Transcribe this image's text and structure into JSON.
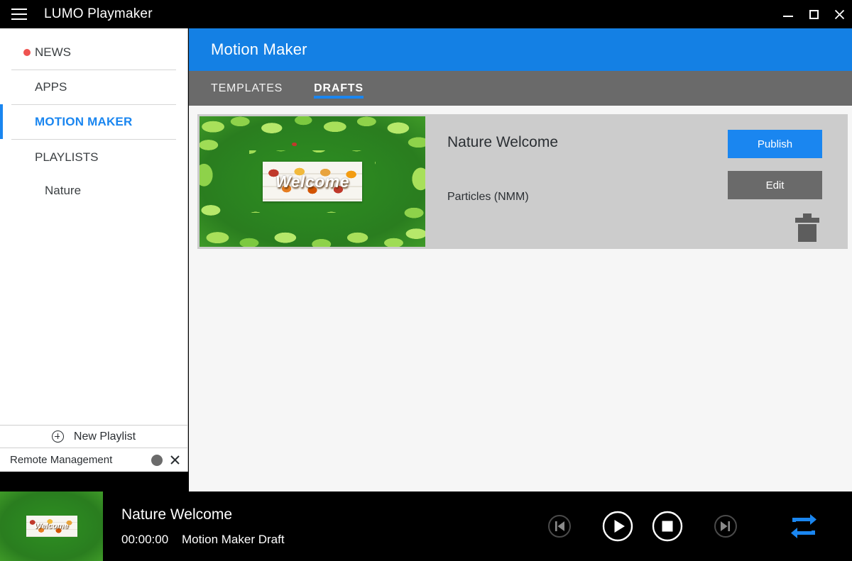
{
  "window": {
    "title": "LUMO Playmaker",
    "menu_icon": "hamburger-icon",
    "minimize_label": "Minimize",
    "maximize_label": "Maximize",
    "close_label": "Close"
  },
  "sidebar": {
    "items": [
      {
        "label": "NEWS",
        "has_dot": true,
        "active": false
      },
      {
        "label": "APPS",
        "has_dot": false,
        "active": false
      },
      {
        "label": "MOTION MAKER",
        "has_dot": false,
        "active": true
      },
      {
        "label": "PLAYLISTS",
        "has_dot": false,
        "active": false
      }
    ],
    "children": [
      {
        "label": "Nature"
      }
    ],
    "new_playlist": "New Playlist",
    "new_playlist_icon": "plus-circle-icon",
    "remote_management": "Remote Management",
    "remote_close_icon": "close-icon"
  },
  "panel": {
    "title": "Motion Maker",
    "tabs": [
      {
        "label": "TEMPLATES",
        "active": false
      },
      {
        "label": "DRAFTS",
        "active": true
      }
    ]
  },
  "draft": {
    "title": "Nature Welcome",
    "subtitle": "Particles (NMM)",
    "thumbnail_text": "Welcome",
    "publish_label": "Publish",
    "edit_label": "Edit",
    "delete_icon": "trash-icon"
  },
  "player": {
    "title": "Nature Welcome",
    "time": "00:00:00",
    "source": "Motion Maker Draft",
    "thumbnail_text": "Welcome",
    "controls": [
      {
        "name": "previous-button",
        "icon": "skip-previous-icon",
        "state": "disabled"
      },
      {
        "name": "play-button",
        "icon": "play-icon",
        "state": "enabled"
      },
      {
        "name": "stop-button",
        "icon": "stop-icon",
        "state": "enabled"
      },
      {
        "name": "next-button",
        "icon": "skip-next-icon",
        "state": "disabled"
      },
      {
        "name": "repeat-button",
        "icon": "repeat-icon",
        "state": "active"
      }
    ]
  },
  "colors": {
    "accent_blue": "#1480e4",
    "tab_gray": "#6a6a6a",
    "card_gray": "#cccccc",
    "content_bg": "#f6f6f6",
    "news_dot_red": "#ef5350",
    "repeat_blue": "#1a86f0"
  }
}
